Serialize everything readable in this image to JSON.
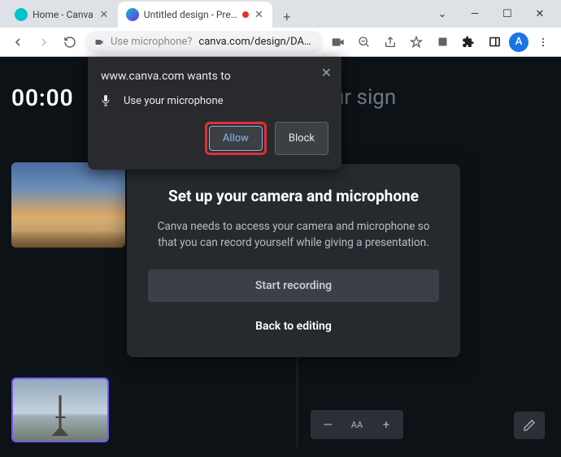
{
  "window": {
    "controls": {
      "minimize": "—",
      "maximize": "☐",
      "close": "✕",
      "chevron": "⌄"
    }
  },
  "tabs": {
    "tab1": {
      "title": "Home - Canva",
      "close": "✕"
    },
    "tab2": {
      "title": "Untitled design - Presen",
      "close": "✕"
    },
    "newtab": "+"
  },
  "toolbar": {
    "omnibox_hint": "Use microphone?",
    "url": "canva.com/design/DA…",
    "avatar_letter": "A"
  },
  "permission": {
    "title": "www.canva.com wants to",
    "line1": "Use your microphone",
    "allow": "Allow",
    "block": "Block",
    "close": "✕"
  },
  "canva": {
    "timer": "00:00",
    "notes_hint": "d notes to your sign",
    "modal": {
      "heading": "Set up your camera and microphone",
      "body": "Canva needs to access your camera and microphone so that you can record yourself while giving a presentation.",
      "start": "Start recording",
      "back": "Back to editing"
    },
    "font_label": "AA",
    "font_minus": "—",
    "font_plus": "+"
  }
}
